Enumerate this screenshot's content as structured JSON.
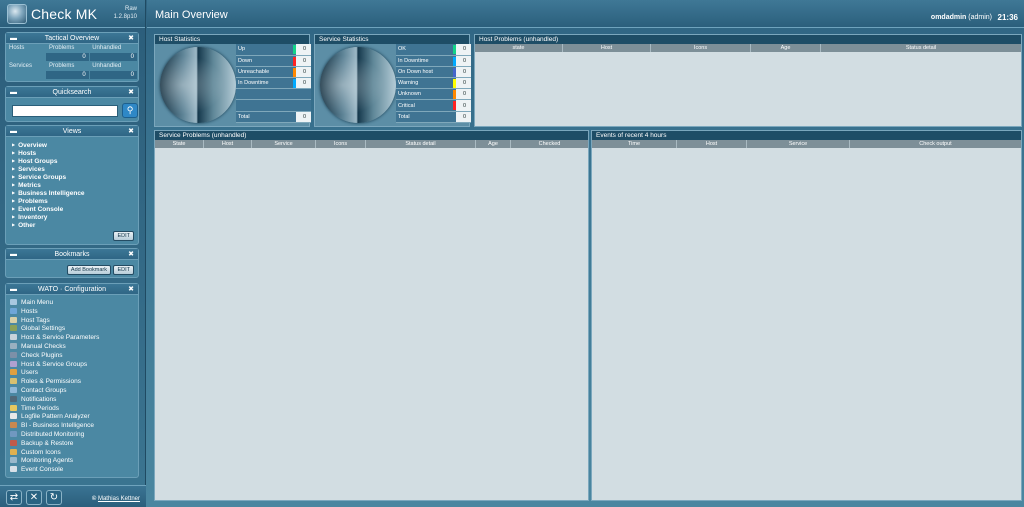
{
  "sidebar": {
    "logo": "Check MK",
    "edition": "Raw",
    "version": "1.2.8p10",
    "tactical": {
      "title": "Tactical Overview",
      "columns": [
        "Problems",
        "Unhandled"
      ],
      "rows": [
        {
          "label": "Hosts",
          "problems": "0",
          "unhandled": "0"
        },
        {
          "label": "Services",
          "problems": "0",
          "unhandled": "0"
        }
      ]
    },
    "quicksearch": {
      "title": "Quicksearch",
      "value": ""
    },
    "views": {
      "title": "Views",
      "items": [
        "Overview",
        "Hosts",
        "Host Groups",
        "Services",
        "Service Groups",
        "Metrics",
        "Business Intelligence",
        "Problems",
        "Event Console",
        "Inventory",
        "Other"
      ],
      "edit": "EDIT"
    },
    "bookmarks": {
      "title": "Bookmarks",
      "add": "Add Bookmark",
      "edit": "EDIT"
    },
    "wato": {
      "title": "WATO · Configuration",
      "items": [
        "Main Menu",
        "Hosts",
        "Host Tags",
        "Global Settings",
        "Host & Service Parameters",
        "Manual Checks",
        "Check Plugins",
        "Host & Service Groups",
        "Users",
        "Roles & Permissions",
        "Contact Groups",
        "Notifications",
        "Time Periods",
        "Logfile Pattern Analyzer",
        "BI - Business Intelligence",
        "Distributed Monitoring",
        "Backup & Restore",
        "Custom Icons",
        "Monitoring Agents",
        "Event Console"
      ]
    },
    "footer": {
      "copyright": "©",
      "author": "Mathias Kettner"
    }
  },
  "header": {
    "title": "Main Overview",
    "user": "omdadmin",
    "role": "(admin)",
    "time": "21:36"
  },
  "host_stats": {
    "title": "Host Statistics",
    "rows": [
      {
        "label": "Up",
        "count": "0",
        "color": "#13d389"
      },
      {
        "label": "Down",
        "count": "0",
        "color": "#ff2222"
      },
      {
        "label": "Unreachable",
        "count": "0",
        "color": "#ff8800"
      },
      {
        "label": "In Downtime",
        "count": "0",
        "color": "#00aaff"
      },
      {
        "label": "",
        "count": "",
        "color": ""
      },
      {
        "label": "",
        "count": "",
        "color": ""
      },
      {
        "label": "Total",
        "count": "0",
        "color": ""
      }
    ]
  },
  "service_stats": {
    "title": "Service Statistics",
    "rows": [
      {
        "label": "OK",
        "count": "0",
        "color": "#13d389"
      },
      {
        "label": "In Downtime",
        "count": "0",
        "color": "#00aaff"
      },
      {
        "label": "On Down host",
        "count": "0",
        "color": "#4466cc"
      },
      {
        "label": "Warning",
        "count": "0",
        "color": "#ffff00"
      },
      {
        "label": "Unknown",
        "count": "0",
        "color": "#ff8800"
      },
      {
        "label": "Critical",
        "count": "0",
        "color": "#ff2222"
      },
      {
        "label": "Total",
        "count": "0",
        "color": ""
      }
    ]
  },
  "host_problems": {
    "title": "Host Problems (unhandled)",
    "columns": [
      "state",
      "Host",
      "Icons",
      "Age",
      "Status detail"
    ]
  },
  "service_problems": {
    "title": "Service Problems (unhandled)",
    "columns": [
      "State",
      "Host",
      "Service",
      "Icons",
      "Status detail",
      "Age",
      "Checked"
    ]
  },
  "events": {
    "title": "Events of recent 4 hours",
    "columns": [
      "Time",
      "Host",
      "Service",
      "Check output"
    ]
  }
}
